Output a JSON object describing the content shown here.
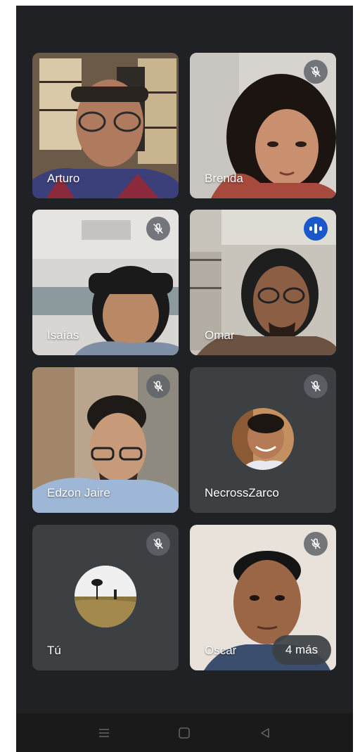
{
  "participants": [
    {
      "name": "Arturo",
      "muted": false,
      "speaking": false
    },
    {
      "name": "Brenda",
      "muted": true,
      "speaking": false
    },
    {
      "name": "Isaías",
      "muted": true,
      "speaking": false
    },
    {
      "name": "Omar",
      "muted": false,
      "speaking": true
    },
    {
      "name": "Edzon Jaire",
      "muted": true,
      "speaking": false
    },
    {
      "name": "NecrossZarco",
      "muted": true,
      "speaking": false
    },
    {
      "name": "Tú",
      "muted": true,
      "speaking": false
    },
    {
      "name": "Oscar",
      "muted": true,
      "speaking": false
    }
  ],
  "more_label": "4 más",
  "colors": {
    "background": "#202124",
    "tile": "#3c4043",
    "speaking_indicator": "#1a58c9",
    "mute_badge": "#5f6368"
  },
  "icons": {
    "mute": "mic-off-icon",
    "speaking": "audio-level-icon",
    "nav": [
      "menu-icon",
      "home-icon",
      "back-icon"
    ]
  }
}
